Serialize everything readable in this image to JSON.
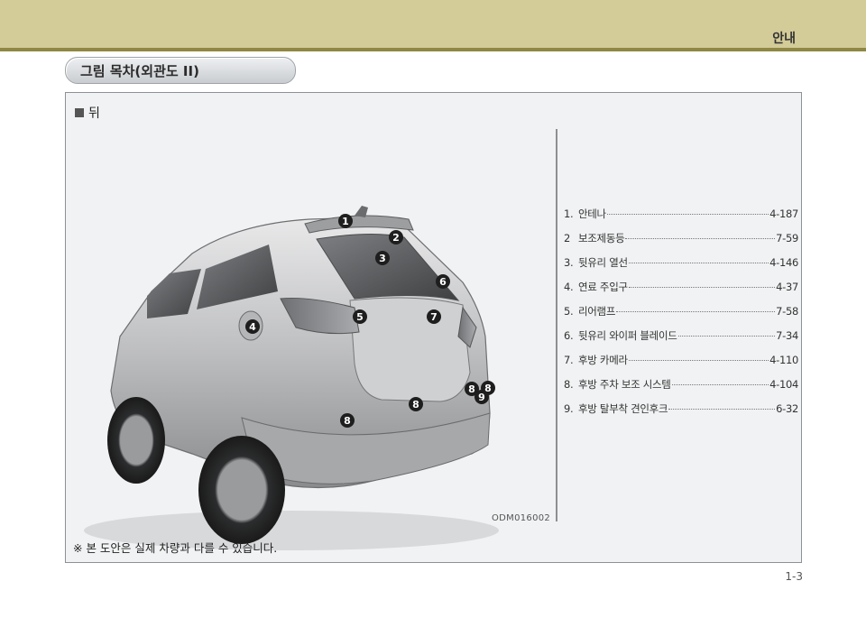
{
  "header": {
    "title": "안내"
  },
  "section": {
    "title": "그림 목차(외관도 II)"
  },
  "figure": {
    "heading": "뒤",
    "image_code": "ODM016002",
    "callouts": [
      "1",
      "2",
      "3",
      "4",
      "5",
      "6",
      "7",
      "8",
      "8",
      "8",
      "8",
      "9"
    ]
  },
  "legend": [
    {
      "num": "1.",
      "name": "안테나",
      "page": "4-187"
    },
    {
      "num": "2",
      "name": "보조제동등",
      "page": "7-59"
    },
    {
      "num": "3.",
      "name": "뒷유리 열선",
      "page": "4-146"
    },
    {
      "num": "4.",
      "name": "연료 주입구",
      "page": "4-37"
    },
    {
      "num": "5.",
      "name": "리어램프",
      "page": "7-58"
    },
    {
      "num": "6.",
      "name": "뒷유리 와이퍼 블레이드",
      "page": "7-34"
    },
    {
      "num": "7.",
      "name": "후방 카메라",
      "page": "4-110"
    },
    {
      "num": "8.",
      "name": "후방 주차 보조 시스템",
      "page": "4-104"
    },
    {
      "num": "9.",
      "name": "후방 탈부착 견인후크",
      "page": "6-32"
    }
  ],
  "note": "※ 본 도안은 실제 차량과 다를 수 있습니다.",
  "page_number": "1-3",
  "colors": {
    "band": "#d3cb98",
    "band_rule": "#8f8743",
    "panel": "#f1f2f3",
    "callout": "#1e1e1e"
  }
}
